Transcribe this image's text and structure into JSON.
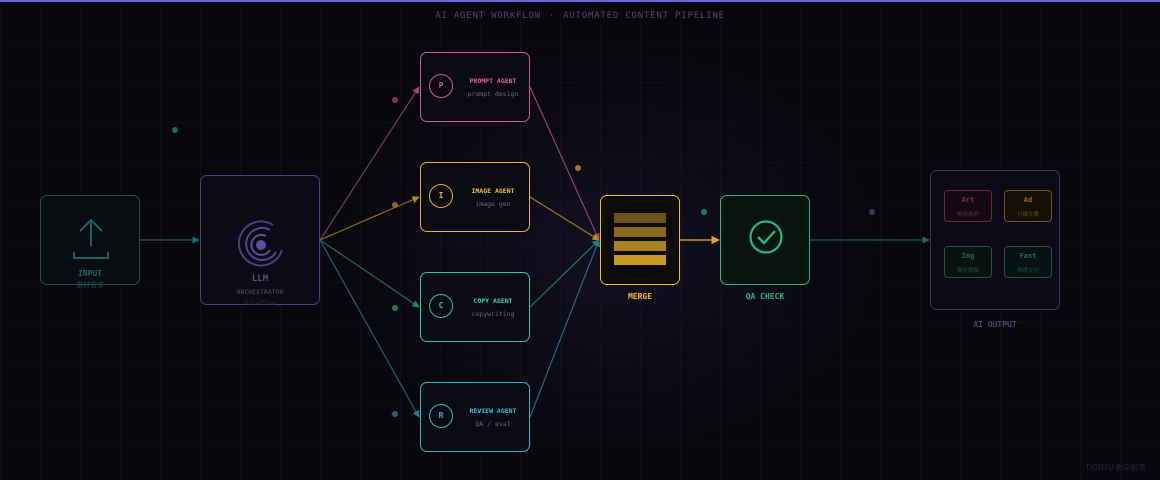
{
  "header": {
    "title": "AI AGENT WORKFLOW",
    "separator": "·",
    "subtitle": "AUTOMATED CONTENT PIPELINE"
  },
  "input": {
    "label": "INPUT",
    "sublabel": "素材需求",
    "icon": "upload-icon"
  },
  "orchestrator": {
    "label": "LLM",
    "sublabel": "ORCHESTRATOR",
    "note": "Ruleflow",
    "icon": "concentric-circles-icon"
  },
  "agents": [
    {
      "initial": "P",
      "name": "PROMPT AGENT",
      "desc": "prompt design",
      "color": "#d255a0"
    },
    {
      "initial": "I",
      "name": "IMAGE AGENT",
      "desc": "image gen",
      "color": "#e8b22e"
    },
    {
      "initial": "C",
      "name": "COPY AGENT",
      "desc": "copywriting",
      "color": "#2cc79a"
    },
    {
      "initial": "R",
      "name": "REVIEW AGENT",
      "desc": "QA / eval",
      "color": "#2fb3c8"
    }
  ],
  "merge": {
    "label": "MERGE",
    "icon": "stack-bars-icon",
    "color": "#f0b72e"
  },
  "qa": {
    "label": "QA CHECK",
    "icon": "check-circle-icon",
    "color": "#2cb57d"
  },
  "output": {
    "label": "AI OUTPUT",
    "tiles": [
      {
        "title": "Art",
        "caption": "美術素材",
        "color": "#8a2d55"
      },
      {
        "title": "Ad",
        "caption": "行銷文案",
        "color": "#8a6b1e"
      },
      {
        "title": "Img",
        "caption": "廣告圖像",
        "color": "#1d6b55"
      },
      {
        "title": "Fast",
        "caption": "快速交付",
        "color": "#1c6b6b"
      }
    ]
  },
  "credit": "TIGNYU 數字創意",
  "colors": {
    "accent_line": "#6b63e6",
    "background": "#07070d"
  }
}
